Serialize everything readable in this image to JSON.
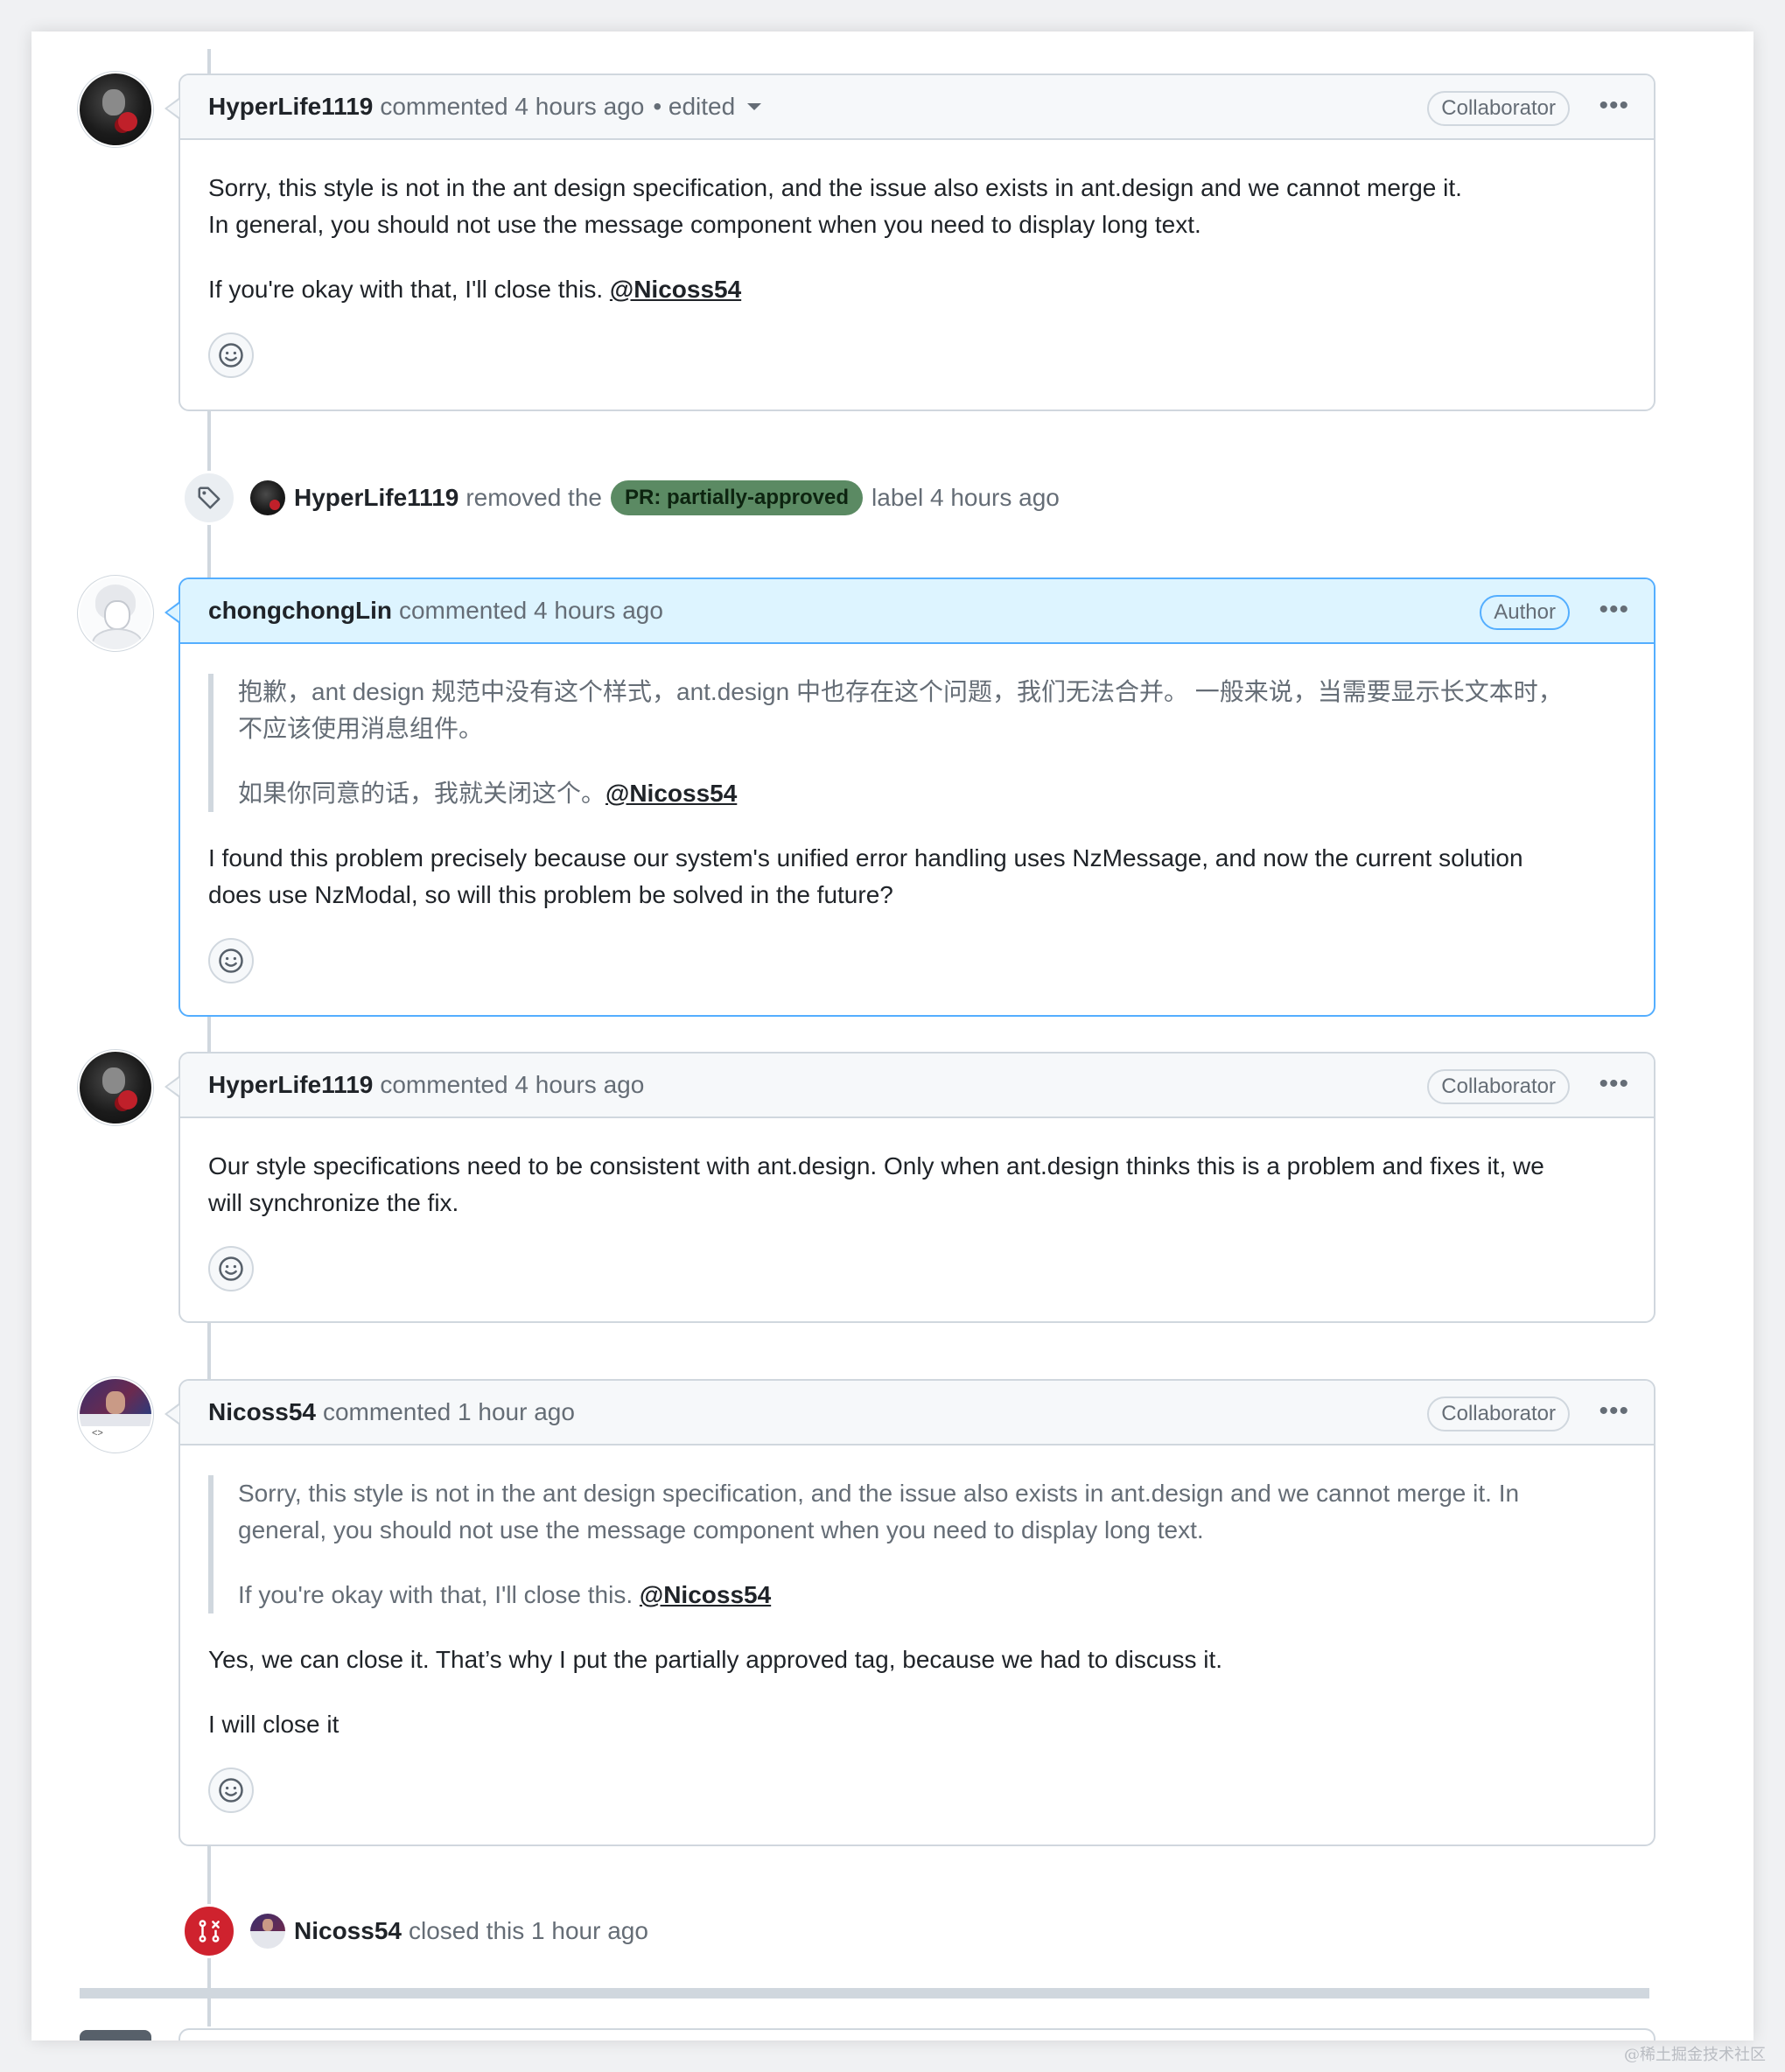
{
  "comments": [
    {
      "author": "HyperLife1119",
      "meta": "commented 4 hours ago",
      "edited": "• edited",
      "role": "Collaborator",
      "paragraphs": [
        "Sorry, this style is not in the ant design specification, and the issue also exists in ant.design and we cannot merge it.",
        "In general, you should not use the message component when you need to display long text."
      ],
      "closing_text": "If you're okay with that, I'll close this.",
      "mention": "@Nicoss54"
    },
    {
      "author": "chongchongLin",
      "meta": "commented 4 hours ago",
      "role": "Author",
      "quote_line1": "抱歉，ant design 规范中没有这个样式，ant.design 中也存在这个问题，我们无法合并。 一般来说，当需要显示长文本时，",
      "quote_line2": "不应该使用消息组件。",
      "quote_closing": "如果你同意的话，我就关闭这个。",
      "quote_mention": "@Nicoss54",
      "reply_line1": "I found this problem precisely because our system's unified error handling uses NzMessage, and now the current solution",
      "reply_line2": "does use NzModal, so will this problem be solved in the future?"
    },
    {
      "author": "HyperLife1119",
      "meta": "commented 4 hours ago",
      "role": "Collaborator",
      "line1": "Our style specifications need to be consistent with ant.design. Only when ant.design thinks this is a problem and fixes it, we",
      "line2": "will synchronize the fix."
    },
    {
      "author": "Nicoss54",
      "meta": "commented 1 hour ago",
      "role": "Collaborator",
      "quote_line1": "Sorry, this style is not in the ant design specification, and the issue also exists in ant.design and we cannot merge it. In",
      "quote_line2": "general, you should not use the message component when you need to display long text.",
      "quote_closing": "If you're okay with that, I'll close this.",
      "quote_mention": "@Nicoss54",
      "reply1": "Yes, we can close it. That’s why I put the partially approved tag, because we had to discuss it.",
      "reply2": "I will close it"
    }
  ],
  "events": {
    "label_removed": {
      "actor": "HyperLife1119",
      "action": "removed the",
      "label": "PR: partially-approved",
      "suffix": "label 4 hours ago",
      "icon": "tag-icon"
    },
    "closed": {
      "actor": "Nicoss54",
      "action": "closed this 1 hour ago",
      "icon": "git-pull-request-closed-icon"
    }
  },
  "icons": {
    "reaction": "smiley-icon",
    "more": "kebab-horizontal-icon"
  },
  "colors": {
    "author_header_bg": "#ddf4ff",
    "author_border": "#54aeff",
    "label_bg": "#5b8a63",
    "closed_red": "#cf222e"
  },
  "watermark": "@稀土掘金技术社区"
}
